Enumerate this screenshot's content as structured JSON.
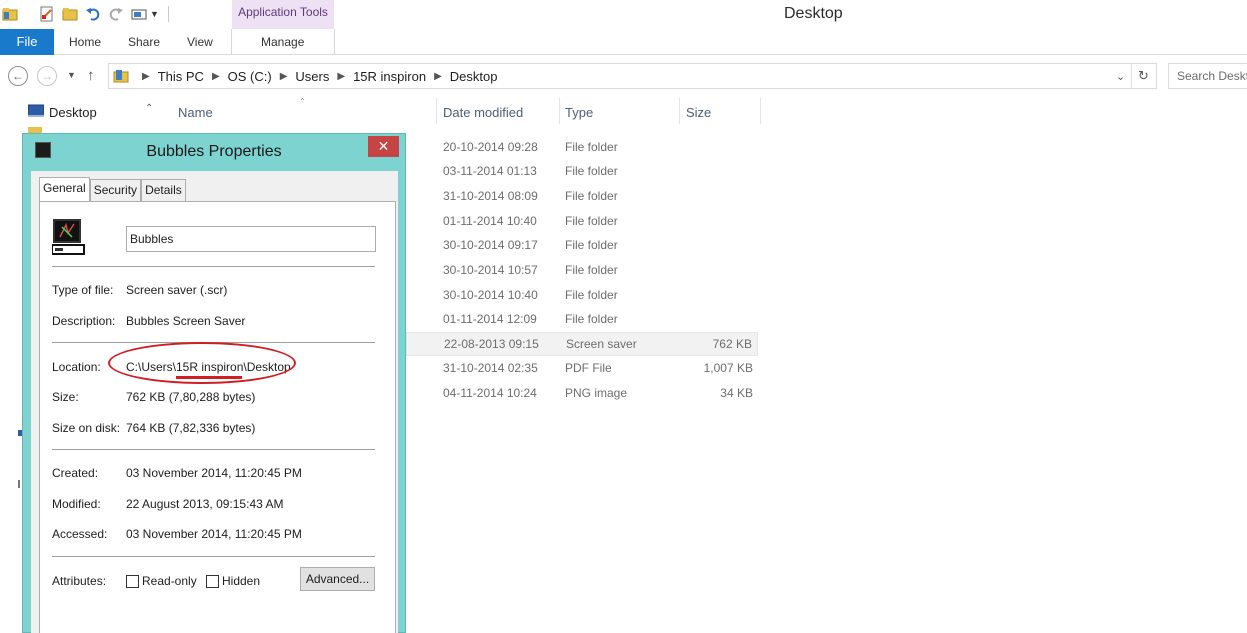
{
  "window": {
    "title": "Desktop"
  },
  "ribbon": {
    "context_header": "Application Tools",
    "tabs": [
      {
        "label": "File"
      },
      {
        "label": "Home"
      },
      {
        "label": "Share"
      },
      {
        "label": "View"
      },
      {
        "label": "Manage"
      }
    ]
  },
  "address": {
    "crumbs": [
      "This PC",
      "OS (C:)",
      "Users",
      "15R inspiron",
      "Desktop"
    ],
    "search_placeholder": "Search Desktop"
  },
  "nav_pane": {
    "items": [
      {
        "label": "Desktop"
      }
    ]
  },
  "file_list": {
    "columns": {
      "name": "Name",
      "date": "Date modified",
      "type": "Type",
      "size": "Size"
    },
    "rows": [
      {
        "date": "20-10-2014 09:28",
        "type": "File folder",
        "size": ""
      },
      {
        "date": "03-11-2014 01:13",
        "type": "File folder",
        "size": ""
      },
      {
        "date": "31-10-2014 08:09",
        "type": "File folder",
        "size": ""
      },
      {
        "date": "01-11-2014 10:40",
        "type": "File folder",
        "size": ""
      },
      {
        "date": "30-10-2014 09:17",
        "type": "File folder",
        "size": ""
      },
      {
        "date": "30-10-2014 10:57",
        "type": "File folder",
        "size": ""
      },
      {
        "date": "30-10-2014 10:40",
        "type": "File folder",
        "size": ""
      },
      {
        "date": "01-11-2014 12:09",
        "type": "File folder",
        "size": ""
      },
      {
        "date": "22-08-2013 09:15",
        "type": "Screen saver",
        "size": "762 KB",
        "selected": true
      },
      {
        "date": "31-10-2014 02:35",
        "type": "PDF File",
        "size": "1,007 KB"
      },
      {
        "date": "04-11-2014 10:24",
        "type": "PNG image",
        "size": "34 KB"
      }
    ]
  },
  "dialog": {
    "title": "Bubbles Properties",
    "tabs": [
      "General",
      "Security",
      "Details"
    ],
    "name_value": "Bubbles",
    "fields": {
      "type_label": "Type of file:",
      "type_value": "Screen saver (.scr)",
      "desc_label": "Description:",
      "desc_value": "Bubbles Screen Saver",
      "loc_label": "Location:",
      "loc_value": "C:\\Users\\15R inspiron\\Desktop",
      "size_label": "Size:",
      "size_value": "762 KB (7,80,288 bytes)",
      "disk_label": "Size on disk:",
      "disk_value": "764 KB (7,82,336 bytes)",
      "created_label": "Created:",
      "created_value": "03 November 2014, 11:20:45 PM",
      "modified_label": "Modified:",
      "modified_value": "22 August 2013, 09:15:43 AM",
      "accessed_label": "Accessed:",
      "accessed_value": "03 November 2014, 11:20:45 PM",
      "attr_label": "Attributes:"
    },
    "readonly_label": "Read-only",
    "hidden_label": "Hidden",
    "advanced_label": "Advanced..."
  },
  "colors": {
    "file_tab": "#1979ca",
    "dialog_frame": "#7dd3cf",
    "close_button": "#c74444",
    "annotation": "#d01f24",
    "context_tab": "#eee1f4"
  }
}
